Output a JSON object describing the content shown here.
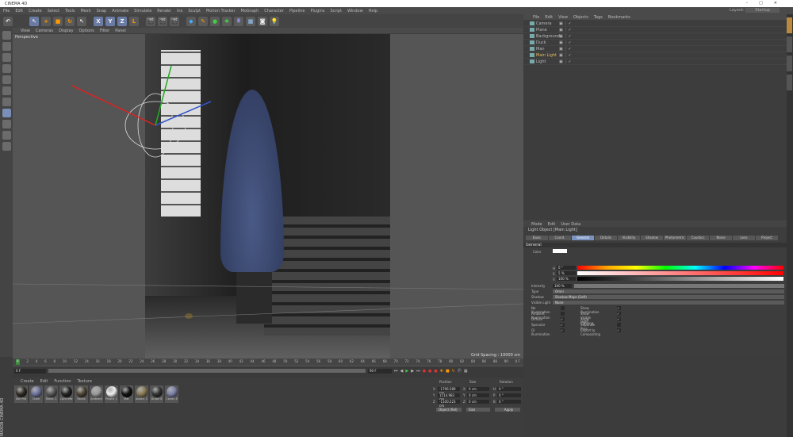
{
  "app": {
    "title": "CINEMA 4D",
    "layout_label": "Layout:",
    "layout_value": "Startup"
  },
  "menu": [
    "File",
    "Edit",
    "Create",
    "Select",
    "Tools",
    "Mesh",
    "Snap",
    "Animate",
    "Simulate",
    "Render",
    "Ins",
    "Sculpt",
    "Motion Tracker",
    "MoGraph",
    "Character",
    "Pipeline",
    "Plugins",
    "Script",
    "Window",
    "Help"
  ],
  "toolbar": {
    "axis": [
      "X",
      "Y",
      "Z"
    ]
  },
  "viewport": {
    "menu": [
      "View",
      "Cameras",
      "Display",
      "Options",
      "Filter",
      "Panel"
    ],
    "label": "Perspective",
    "grid_spacing": "Grid Spacing : 10000 cm"
  },
  "object_manager": {
    "menu": [
      "File",
      "Edit",
      "View",
      "Objects",
      "Tags",
      "Bookmarks"
    ],
    "objects": [
      {
        "name": "Camera"
      },
      {
        "name": "Plane"
      },
      {
        "name": "Background"
      },
      {
        "name": "Duck"
      },
      {
        "name": "Man"
      },
      {
        "name": "Main Light",
        "selected": true
      },
      {
        "name": "Light"
      }
    ]
  },
  "attributes": {
    "menu": [
      "Mode",
      "Edit",
      "User Data"
    ],
    "title": "Light Object [Main Light]",
    "tabs": [
      "Basic",
      "Coord.",
      "General",
      "Details",
      "Visibility",
      "Shadow",
      "Photometric",
      "Caustics",
      "Noise",
      "Lens",
      "Project"
    ],
    "active_tab": "General",
    "section": "General",
    "color_label": "Color",
    "color": "#ffffff",
    "h_label": "H",
    "h": "0 °",
    "s_label": "S",
    "s": "5 %",
    "v_label": "V",
    "v": "100 %",
    "intensity_label": "Intensity",
    "intensity": "100 %",
    "type_label": "Type",
    "type": "Omni",
    "shadow_label": "Shadow",
    "shadow": "Shadow Maps (Soft)",
    "visible_light_label": "Visible Light",
    "visible_light": "None",
    "left_checks": [
      {
        "label": "No Illumination",
        "checked": false
      },
      {
        "label": "Ambient Illumination",
        "checked": false
      },
      {
        "label": "Diffuse",
        "checked": true
      },
      {
        "label": "Specular",
        "checked": true
      },
      {
        "label": "GI Illumination",
        "checked": true
      }
    ],
    "right_checks": [
      {
        "label": "Show Illumination",
        "checked": true
      },
      {
        "label": "Show Visible Light",
        "checked": true
      },
      {
        "label": "Show Clipping",
        "checked": true
      },
      {
        "label": "Separate Pass",
        "checked": false
      },
      {
        "label": "Export to Compositing",
        "checked": true
      }
    ]
  },
  "timeline": {
    "ticks": [
      "0",
      "2",
      "4",
      "6",
      "8",
      "10",
      "12",
      "14",
      "16",
      "18",
      "20",
      "22",
      "24",
      "26",
      "28",
      "30",
      "32",
      "34",
      "36",
      "38",
      "40",
      "42",
      "44",
      "46",
      "48",
      "50",
      "52",
      "54",
      "56",
      "58",
      "60",
      "62",
      "64",
      "66",
      "68",
      "70",
      "72",
      "74",
      "76",
      "78",
      "80",
      "82",
      "84",
      "86",
      "88",
      "90"
    ],
    "current": "0 F",
    "start": "0 F",
    "end": "90 F",
    "end_marker": "0 F"
  },
  "materials": {
    "menu": [
      "Create",
      "Edit",
      "Function",
      "Texture"
    ],
    "items": [
      {
        "name": "Soil Pile",
        "color": "#2e2a24"
      },
      {
        "name": "Cloth",
        "color": "#6a7098"
      },
      {
        "name": "Fabric 1",
        "color": "#555"
      },
      {
        "name": "Concrete",
        "color": "#222"
      },
      {
        "name": "Rocks",
        "color": "#4a4233"
      },
      {
        "name": "Ambient",
        "color": "#999"
      },
      {
        "name": "Plastic 1",
        "color": "#eee"
      },
      {
        "name": "Mat",
        "color": "#111"
      },
      {
        "name": "plastic 2",
        "color": "#8a7a55"
      },
      {
        "name": "Drape 8",
        "color": "#333"
      },
      {
        "name": "Candy 8",
        "color": "#7a80a8"
      }
    ]
  },
  "coordinates": {
    "headers": [
      "Position",
      "Size",
      "Rotation"
    ],
    "rows": [
      {
        "axis": "X",
        "pos": "-1796.589 cm",
        "size_axis": "X",
        "size": "0 cm",
        "rot_axis": "H",
        "rot": "0 °"
      },
      {
        "axis": "Y",
        "pos": "1514.983 cm",
        "size_axis": "Y",
        "size": "0 cm",
        "rot_axis": "P",
        "rot": "0 °"
      },
      {
        "axis": "Z",
        "pos": "-1100.223 cm",
        "size_axis": "Z",
        "size": "0 cm",
        "rot_axis": "B",
        "rot": "0 °"
      }
    ],
    "mode": "Object (Rel)",
    "size_mode": "Size",
    "apply": "Apply"
  },
  "branding": "MAXON CINEMA 4D"
}
